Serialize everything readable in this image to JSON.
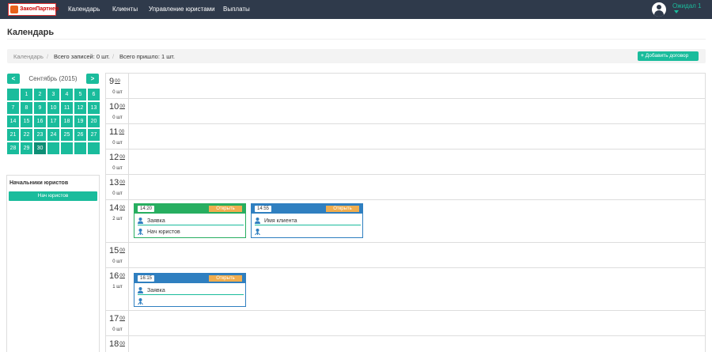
{
  "nav": {
    "logo_text": "ЗаконПартнер",
    "items": [
      "Календарь",
      "Клиенты",
      "Управление юристами",
      "Выплаты"
    ],
    "user_name": "Ожидал 1"
  },
  "page": {
    "title": "Календарь"
  },
  "breadcrumb": {
    "items": [
      "Календарь",
      "Всего записей: 0 шт.",
      "Всего пришло: 1 шт."
    ],
    "add_button": "Добавить договор"
  },
  "calendar": {
    "prev": "<",
    "next": ">",
    "title": "Сентябрь (2015)",
    "days": [
      "",
      "1",
      "2",
      "3",
      "4",
      "5",
      "6",
      "7",
      "8",
      "9",
      "10",
      "11",
      "12",
      "13",
      "14",
      "15",
      "16",
      "17",
      "18",
      "19",
      "20",
      "21",
      "22",
      "23",
      "24",
      "25",
      "26",
      "27",
      "28",
      "29",
      "30",
      "",
      "",
      "",
      ""
    ],
    "selected": "30"
  },
  "panel": {
    "title": "Начальники юристов",
    "button": "Нач юристов"
  },
  "schedule": {
    "slots": [
      {
        "hour": "9",
        "minutes": "00",
        "count": "0 шт"
      },
      {
        "hour": "10",
        "minutes": "00",
        "count": "0 шт"
      },
      {
        "hour": "11",
        "minutes": "00",
        "count": "0 шт"
      },
      {
        "hour": "12",
        "minutes": "00",
        "count": "0 шт"
      },
      {
        "hour": "13",
        "minutes": "00",
        "count": "0 шт"
      },
      {
        "hour": "14",
        "minutes": "00",
        "count": "2 шт"
      },
      {
        "hour": "15",
        "minutes": "00",
        "count": "0 шт"
      },
      {
        "hour": "16",
        "minutes": "00",
        "count": "1 шт"
      },
      {
        "hour": "17",
        "minutes": "00",
        "count": "0 шт"
      },
      {
        "hour": "18",
        "minutes": "00",
        "count": ""
      }
    ],
    "cards": [
      {
        "time": "14:20",
        "open": "Открыть",
        "client": "Заявка",
        "lawyer": "Нач юристов",
        "header_color": "#27ae60"
      },
      {
        "time": "14:55",
        "open": "Открыть",
        "client": "Имя клиента",
        "lawyer": "",
        "header_color": "#2f7fc0"
      },
      {
        "time": "16:15",
        "open": "Открыть",
        "client": "Заявка",
        "lawyer": "",
        "header_color": "#2f7fc0"
      }
    ]
  },
  "colors": {
    "navbar": "#2f3a4b",
    "accent": "#1abc9c",
    "open_button": "#f0ad4e",
    "card_blue": "#2f7fc0",
    "card_green": "#27ae60"
  },
  "icons": [
    "user-icon",
    "lawyer-icon",
    "plus-icon",
    "avatar-icon",
    "caret-down-icon"
  ]
}
